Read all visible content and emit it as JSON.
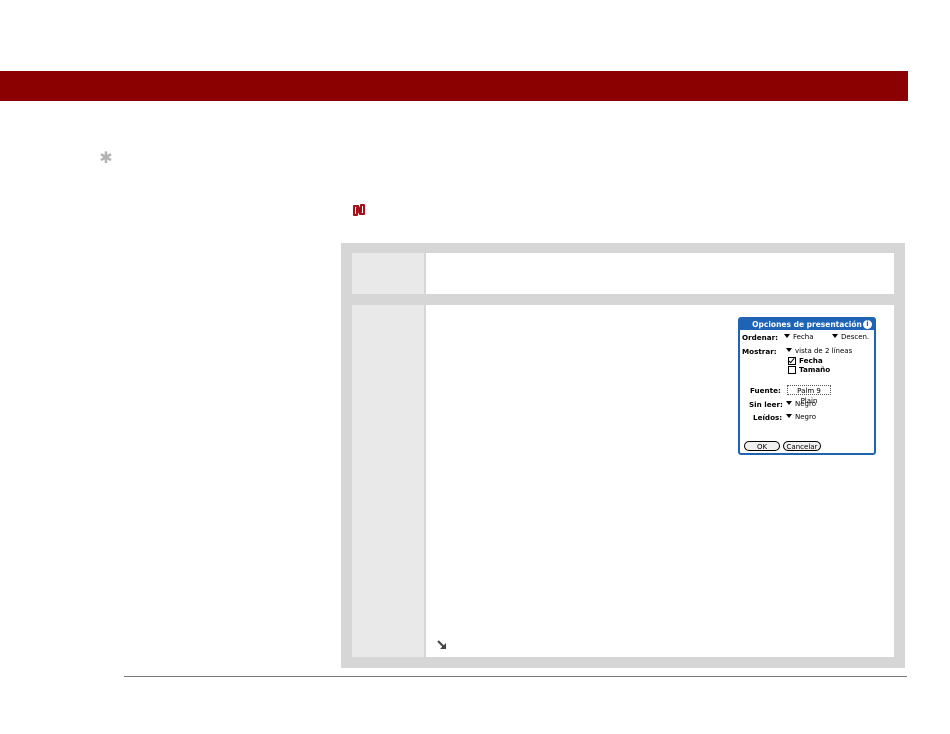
{
  "colors": {
    "header_bar": "#8b0000",
    "table_frame": "#d6d6d6",
    "left_cell": "#e9e9e9",
    "dialog_accent": "#1e63b4"
  },
  "icons": {
    "star": "asterisk-icon",
    "tip": "tip-icon",
    "arrow": "arrow-down-right-icon"
  },
  "dialog": {
    "title": "Opciones de presentación",
    "ordenar_label": "Ordenar:",
    "ordenar_value": "Fecha",
    "ordenar_dir": "Descen.",
    "mostrar_label": "Mostrar:",
    "mostrar_value": "vista de 2 líneas",
    "fecha_label": "Fecha",
    "fecha_checked": true,
    "tamano_label": "Tamaño",
    "tamano_checked": false,
    "fuente_label": "Fuente:",
    "fuente_value": "Palm 9 Plain",
    "sinleer_label": "Sin leer:",
    "sinleer_value": "Negro",
    "leidos_label": "Leídos:",
    "leidos_value": "Negro",
    "ok_label": "OK",
    "cancel_label": "Cancelar"
  }
}
